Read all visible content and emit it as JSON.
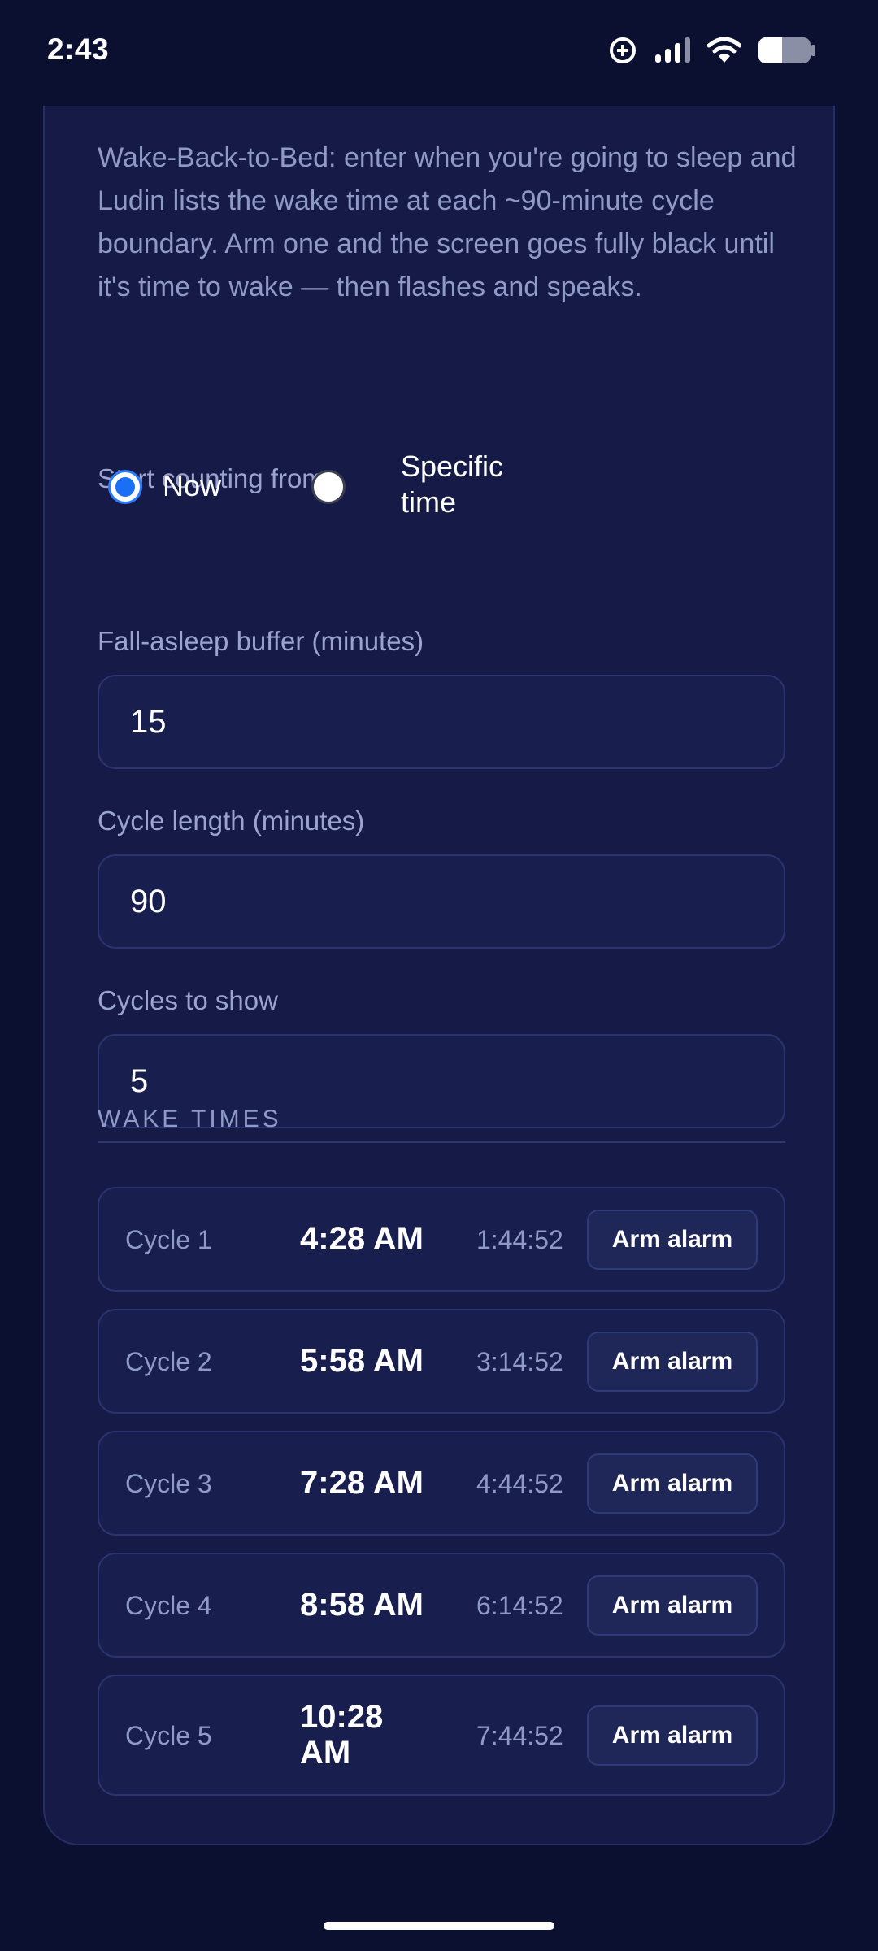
{
  "status_bar": {
    "time": "2:43",
    "icons": [
      "data-saver-icon",
      "signal-icon",
      "wifi-icon",
      "battery-icon"
    ]
  },
  "intro_text": "Wake-Back-to-Bed: enter when you're going to sleep and Ludin lists the wake time at each ~90-minute cycle boundary. Arm one and the screen goes fully black until it's time to wake — then flashes and speaks.",
  "start_from": {
    "label": "Start counting from",
    "options": [
      {
        "label": "Now",
        "selected": true
      },
      {
        "label": "Specific time",
        "selected": false
      }
    ]
  },
  "buffer": {
    "label": "Fall-asleep buffer (minutes)",
    "value": "15"
  },
  "cycle_length": {
    "label": "Cycle length (minutes)",
    "value": "90"
  },
  "cycles_to_show": {
    "label": "Cycles to show",
    "value": "5"
  },
  "wake_times": {
    "title": "WAKE TIMES",
    "rows": [
      {
        "cycle": "Cycle 1",
        "time": "4:28 AM",
        "remaining": "1:44:52",
        "button": "Arm alarm"
      },
      {
        "cycle": "Cycle 2",
        "time": "5:58 AM",
        "remaining": "3:14:52",
        "button": "Arm alarm"
      },
      {
        "cycle": "Cycle 3",
        "time": "7:28 AM",
        "remaining": "4:44:52",
        "button": "Arm alarm"
      },
      {
        "cycle": "Cycle 4",
        "time": "8:58 AM",
        "remaining": "6:14:52",
        "button": "Arm alarm"
      },
      {
        "cycle": "Cycle 5",
        "time": "10:28 AM",
        "remaining": "7:44:52",
        "button": "Arm alarm"
      }
    ]
  },
  "colors": {
    "background": "#0c1030",
    "card": "#151b46",
    "accent": "#1a6ff5",
    "muted_text": "#8f9ac6"
  }
}
